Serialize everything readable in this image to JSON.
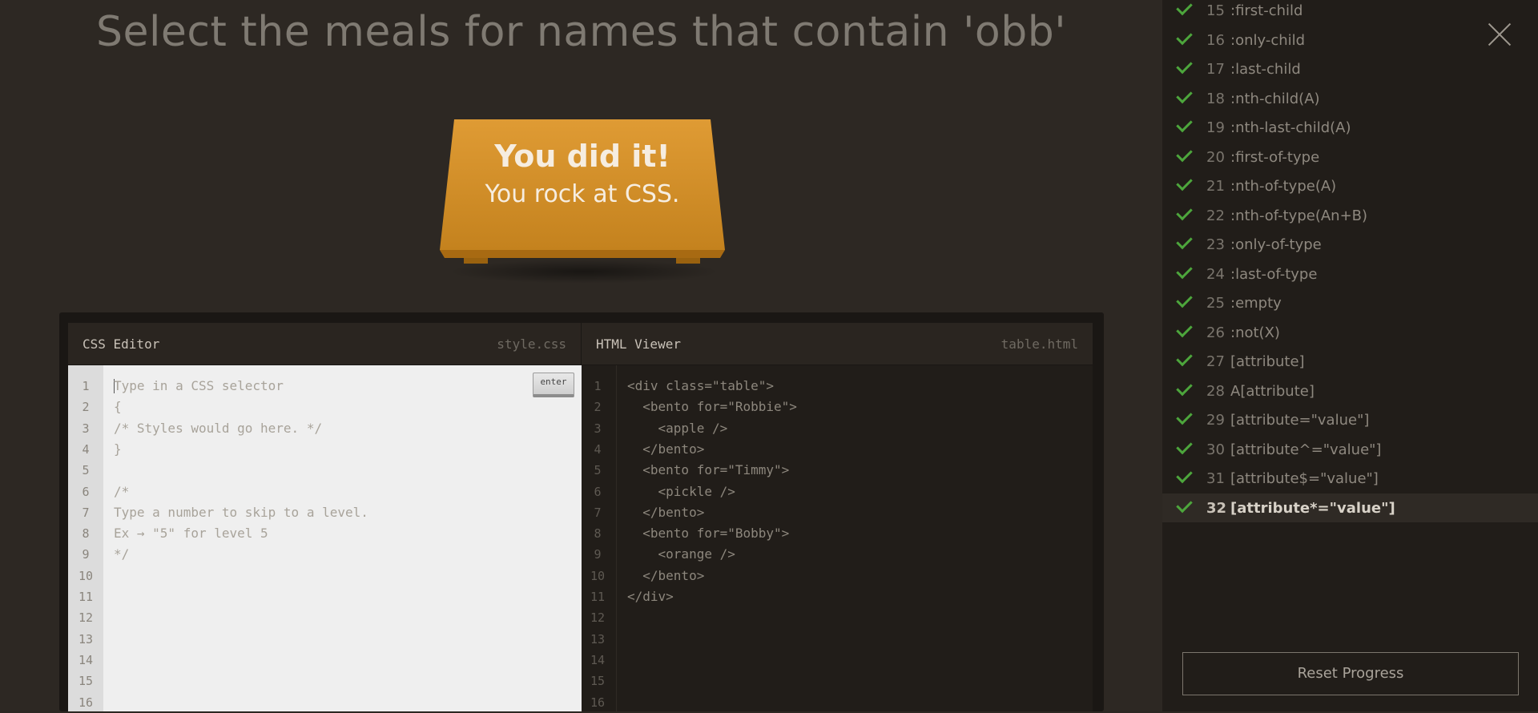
{
  "instruction": "Select the meals for names that contain 'obb'",
  "table_message": {
    "line1": "You did it!",
    "line2": "You rock at CSS."
  },
  "css_editor": {
    "title": "CSS Editor",
    "filename": "style.css",
    "enter_label": "enter",
    "placeholder": "Type in a CSS selector",
    "lines": [
      "{",
      "/* Styles would go here. */",
      "}",
      "",
      "/*",
      "Type a number to skip to a level.",
      "Ex → \"5\" for level 5",
      "*/"
    ],
    "line_numbers": [
      "1",
      "2",
      "3",
      "4",
      "5",
      "6",
      "7",
      "8",
      "9",
      "10",
      "11",
      "12",
      "13",
      "14",
      "15",
      "16"
    ]
  },
  "html_viewer": {
    "title": "HTML Viewer",
    "filename": "table.html",
    "lines": [
      "<div class=\"table\">",
      "  <bento for=\"Robbie\">",
      "    <apple />",
      "  </bento>",
      "  <bento for=\"Timmy\">",
      "    <pickle />",
      "  </bento>",
      "  <bento for=\"Bobby\">",
      "    <orange />",
      "  </bento>",
      "</div>"
    ],
    "line_numbers": [
      "1",
      "2",
      "3",
      "4",
      "5",
      "6",
      "7",
      "8",
      "9",
      "10",
      "11",
      "12",
      "13",
      "14",
      "15",
      "16"
    ]
  },
  "sidebar": {
    "levels": [
      {
        "num": "15",
        "selector": ":first-child",
        "done": true
      },
      {
        "num": "16",
        "selector": ":only-child",
        "done": true
      },
      {
        "num": "17",
        "selector": ":last-child",
        "done": true
      },
      {
        "num": "18",
        "selector": ":nth-child(A)",
        "done": true
      },
      {
        "num": "19",
        "selector": ":nth-last-child(A)",
        "done": true
      },
      {
        "num": "20",
        "selector": ":first-of-type",
        "done": true
      },
      {
        "num": "21",
        "selector": ":nth-of-type(A)",
        "done": true
      },
      {
        "num": "22",
        "selector": ":nth-of-type(An+B)",
        "done": true
      },
      {
        "num": "23",
        "selector": ":only-of-type",
        "done": true
      },
      {
        "num": "24",
        "selector": ":last-of-type",
        "done": true
      },
      {
        "num": "25",
        "selector": ":empty",
        "done": true
      },
      {
        "num": "26",
        "selector": ":not(X)",
        "done": true
      },
      {
        "num": "27",
        "selector": "[attribute]",
        "done": true
      },
      {
        "num": "28",
        "selector": "A[attribute]",
        "done": true
      },
      {
        "num": "29",
        "selector": "[attribute=\"value\"]",
        "done": true
      },
      {
        "num": "30",
        "selector": "[attribute^=\"value\"]",
        "done": true
      },
      {
        "num": "31",
        "selector": "[attribute$=\"value\"]",
        "done": true
      },
      {
        "num": "32",
        "selector": "[attribute*=\"value\"]",
        "done": true,
        "active": true
      }
    ],
    "reset_label": "Reset Progress",
    "close_icon": "close-icon",
    "check_icon": "check-icon",
    "check_color": "#4da63c"
  }
}
